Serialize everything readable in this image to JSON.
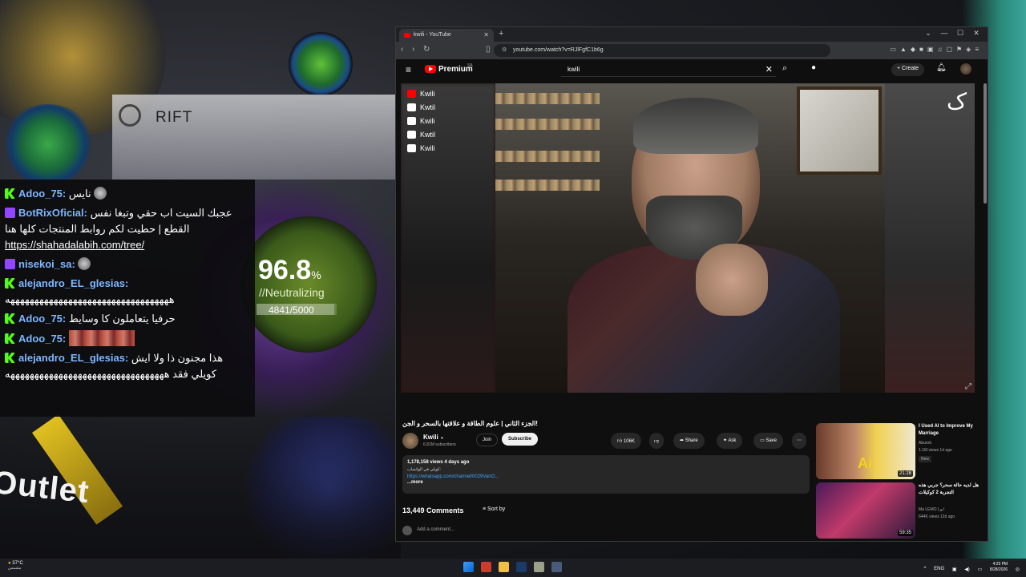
{
  "game": {
    "rift_title": "RIFT",
    "neutralize_value": "96.8",
    "neutralize_unit": "%",
    "neutralize_label": "//Neutralizing",
    "progress_text": "4841/5000",
    "progress_fraction": 0.968,
    "outlet_text": "Outlet"
  },
  "chat": {
    "messages": [
      {
        "platform": "kick",
        "user": "Adoo_75:",
        "user_color": "#7eb6ff",
        "text": "نايس"
      },
      {
        "platform": "twitch",
        "user": "BotRixOficial:",
        "user_color": "#7eb6ff",
        "text": "عجبك السيت اب حقي وتبغا نفس القطع | حطيت لكم روابط المنتجات كلها هنا",
        "link": "https://shahadalabih.com/tree/"
      },
      {
        "platform": "twitch",
        "user": "nisekoi_sa:",
        "user_color": "#7eb6ff",
        "text": ""
      },
      {
        "platform": "kick",
        "user": "alejandro_EL_glesias:",
        "user_color": "#7eb6ff",
        "text": "ههههههههههههههههههههههههههههههههههه"
      },
      {
        "platform": "kick",
        "user": "Adoo_75:",
        "user_color": "#7eb6ff",
        "text": "حرفيا يتعاملون كا وسايط"
      },
      {
        "platform": "kick",
        "user": "Adoo_75:",
        "user_color": "#7eb6ff",
        "text": ""
      },
      {
        "platform": "kick",
        "user": "alejandro_EL_glesias:",
        "user_color": "#7eb6ff",
        "text": "هذا مجنون ذا ولا ايش كويلي فقد هههههههههههههههههههههههههههههههههه"
      }
    ]
  },
  "browser": {
    "tab_title": "kwili - YouTube",
    "url": "youtube.com/watch?v=RJlFgfC1b6g"
  },
  "youtube": {
    "brand": "Premium",
    "brand_region": "SA",
    "search_value": "kwili",
    "create_label": "Create",
    "socials": [
      {
        "icon": "youtube-icon",
        "label": "Kwili"
      },
      {
        "icon": "instagram-icon",
        "label": "Kwtil"
      },
      {
        "icon": "snapchat-icon",
        "label": "Kwili"
      },
      {
        "icon": "twitter-icon",
        "label": "Kwtil"
      },
      {
        "icon": "tiktok-icon",
        "label": "Kwili"
      }
    ],
    "video_title": "الجزء الثاني | علوم الطاقة و علاقتها بالسحر و الجن!",
    "channel": {
      "name": "Kwili",
      "subscribers": "6.81M subscribers"
    },
    "buttons": {
      "join": "Join",
      "subscribe": "Subscribe",
      "likes": "106K",
      "share": "Share",
      "ask": "Ask",
      "save": "Save"
    },
    "description": {
      "stats": "1,178,158 views  4 days ago",
      "line": "كويلي في الواتساب:",
      "link": "https://whatsapp.com/channel/0029VanO...",
      "more": "...more"
    },
    "comments": {
      "count": "13,449 Comments",
      "sort_label": "Sort by",
      "add_placeholder": "Add a comment..."
    },
    "recommended": [
      {
        "title": "I Used AI to Improve My Marriage",
        "channel": "Aburob",
        "meta": "1.1M views  1d ago",
        "badge": "New",
        "duration": "21:28"
      },
      {
        "title": "هل لديه حالة سحر؟ جربي هذه التجربة 2 كوكيلات",
        "channel": "Ma LEMO | ابو",
        "meta": "644K views  12d ago",
        "badge": "",
        "duration": "59:35"
      }
    ]
  },
  "taskbar": {
    "weather_temp": "37°C",
    "weather_desc": "مشمس",
    "lang": "ENG",
    "time": "4:29 PM",
    "date": "8/28/2026"
  }
}
